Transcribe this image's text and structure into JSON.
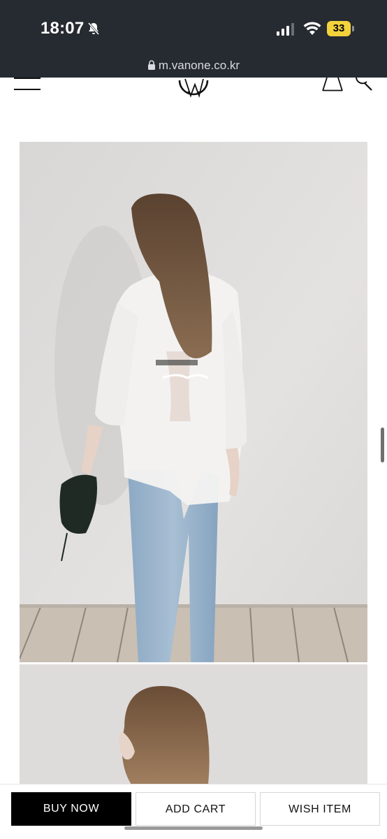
{
  "status_bar": {
    "time": "18:07",
    "battery": "33",
    "icons": [
      "bell-slash-icon",
      "signal-icon",
      "wifi-icon",
      "battery-charging-icon"
    ]
  },
  "browser": {
    "url": "m.vanone.co.kr"
  },
  "header": {
    "icons": [
      "menu-icon",
      "logo",
      "shopping-bag-icon",
      "search-icon"
    ]
  },
  "actions": {
    "buy_now": "BUY NOW",
    "add_cart": "ADD CART",
    "wish_item": "WISH ITEM"
  },
  "colors": {
    "status_bar_bg": "#262a31",
    "battery_accent": "#f3d23b",
    "primary_button": "#000000"
  }
}
